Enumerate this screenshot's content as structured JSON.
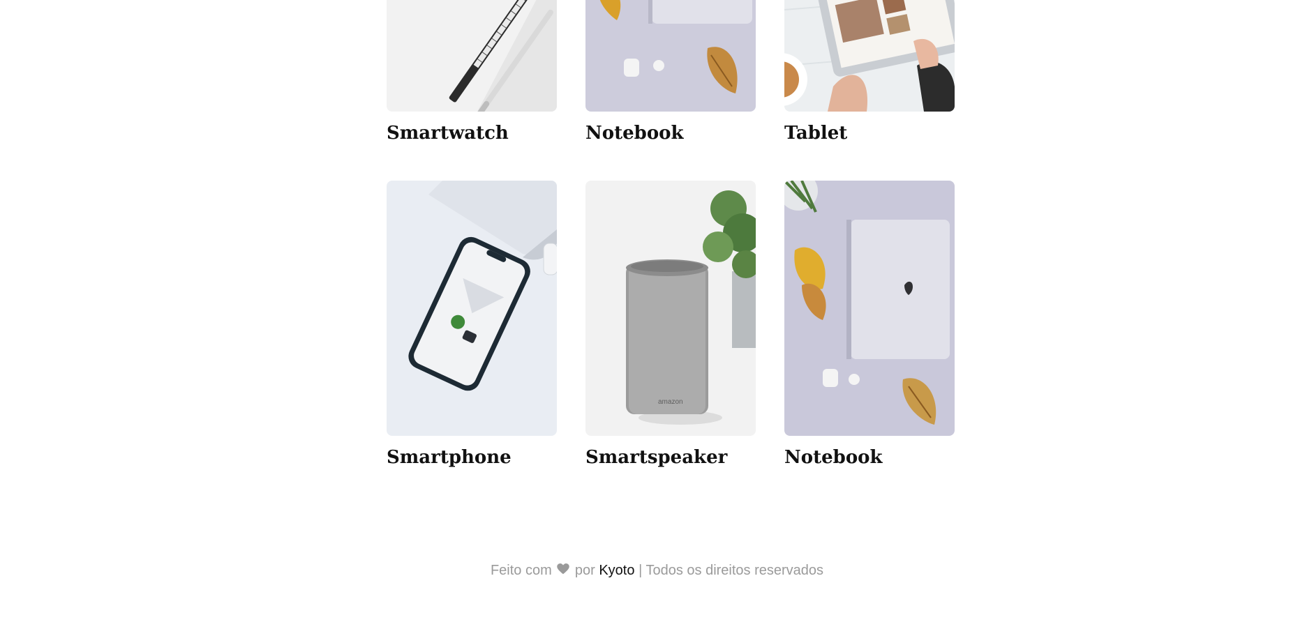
{
  "products": [
    {
      "title": "Smartwatch",
      "image": "pens-on-desk"
    },
    {
      "title": "Notebook",
      "image": "laptop-with-leaves-and-earbuds"
    },
    {
      "title": "Tablet",
      "image": "tablet-in-hands-with-tea"
    },
    {
      "title": "Smartphone",
      "image": "phone-on-desk-near-laptop"
    },
    {
      "title": "Smartspeaker",
      "image": "gray-smart-speaker-with-plant"
    },
    {
      "title": "Notebook",
      "image": "laptop-with-leaves-and-earbuds"
    }
  ],
  "footer": {
    "made_with": "Feito com",
    "heart_icon": "heart-icon",
    "by": "por",
    "brand": "Kyoto",
    "separator": "|",
    "rights": "Todos os direitos reservados"
  },
  "colors": {
    "background": "#ffffff",
    "title": "#111111",
    "footer_text": "#9a9a9a",
    "heart": "#9a9a9a"
  }
}
